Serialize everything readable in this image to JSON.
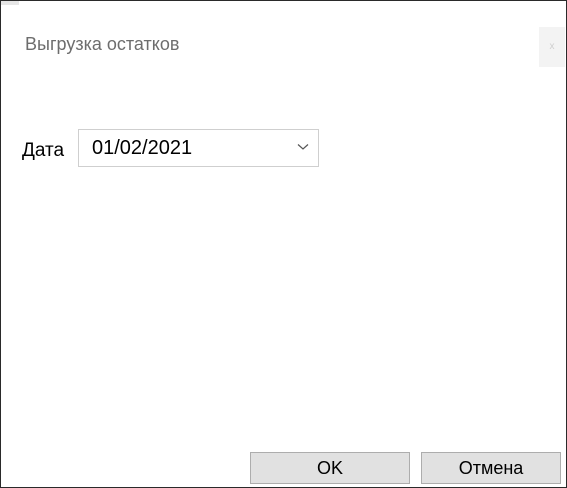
{
  "window": {
    "title": "Выгрузка остатков",
    "close_label": "x"
  },
  "form": {
    "date_label": "Дата",
    "date_value": "01/02/2021",
    "dropdown_icon": "chevron-down-icon"
  },
  "buttons": {
    "ok_label": "OK",
    "cancel_label": "Отмена"
  },
  "colors": {
    "title_text": "#6d6d6d",
    "button_bg": "#e1e1e1",
    "button_border": "#adadad",
    "window_border": "#2a2a2a"
  }
}
